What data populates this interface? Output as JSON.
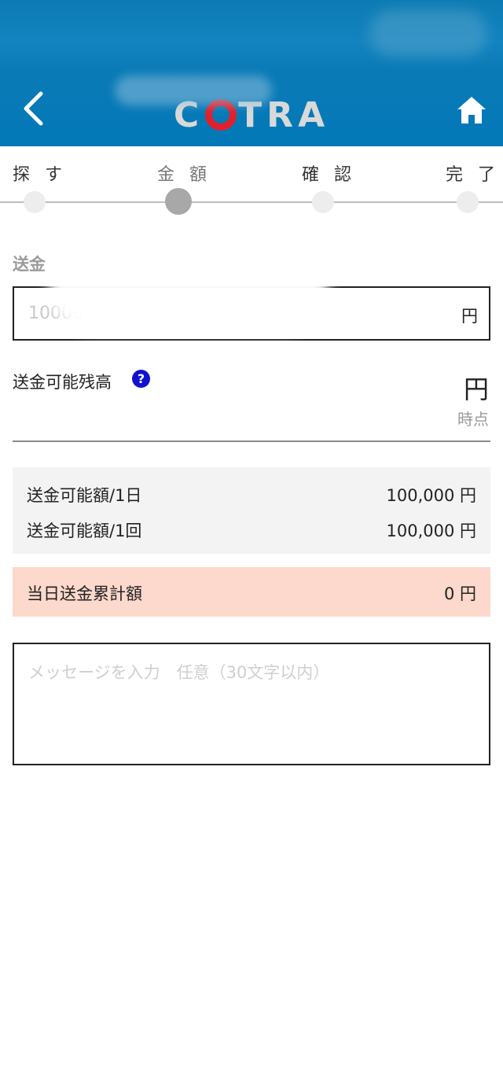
{
  "header": {
    "logo_text_left": "C",
    "logo_text_right": "TRA",
    "brand_color": "#0a7ab6",
    "logo_ring_color": "#e0202b",
    "back_icon": "chevron-left-icon",
    "home_icon": "home-icon"
  },
  "stepper": {
    "steps": [
      {
        "label": "探 す",
        "active": false
      },
      {
        "label": "金 額",
        "active": true
      },
      {
        "label": "確 認",
        "active": false
      },
      {
        "label": "完 了",
        "active": false
      }
    ]
  },
  "amount": {
    "label": "送金",
    "placeholder": "10000",
    "suffix": "円"
  },
  "balance": {
    "label": "送金可能残高",
    "help_icon_text": "?",
    "value_suffix": "円",
    "timestamp_suffix": "時点"
  },
  "limits": [
    {
      "label": "送金可能額/1日",
      "value": "100,000 円"
    },
    {
      "label": "送金可能額/1回",
      "value": "100,000 円"
    }
  ],
  "cumulative": {
    "label": "当日送金累計額",
    "value": "0 円",
    "background": "#fdd8cc"
  },
  "message": {
    "placeholder": "メッセージを入力　任意（30文字以内）"
  }
}
